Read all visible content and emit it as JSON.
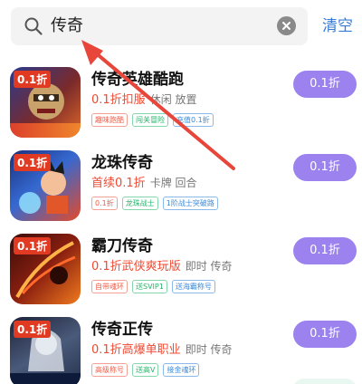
{
  "search": {
    "query": "传奇",
    "cancel_label": "清空"
  },
  "games": [
    {
      "title": "传奇英雄酷跑",
      "promo": "0.1折扣服",
      "category": "休闲 放置",
      "button": "0.1折",
      "icon_badge": "0.1折",
      "tags": [
        {
          "text": "趣味跑酷",
          "color": "red"
        },
        {
          "text": "闯关冒险",
          "color": "green"
        },
        {
          "text": "充值0.1折",
          "color": "blue"
        }
      ]
    },
    {
      "title": "龙珠传奇",
      "promo": "首续0.1折",
      "category": "卡牌 回合",
      "button": "0.1折",
      "icon_badge": "0.1折",
      "tags": [
        {
          "text": "0.1折",
          "color": "red"
        },
        {
          "text": "龙珠战士",
          "color": "green"
        },
        {
          "text": "1阶战士突破路",
          "color": "blue"
        }
      ]
    },
    {
      "title": "霸刀传奇",
      "promo": "0.1折武侠爽玩版",
      "category": "即时 传奇",
      "button": "0.1折",
      "icon_badge": "0.1折",
      "tags": [
        {
          "text": "自带魂环",
          "color": "red"
        },
        {
          "text": "送SVIP1",
          "color": "green"
        },
        {
          "text": "送海霸称号",
          "color": "blue"
        }
      ]
    },
    {
      "title": "传奇正传",
      "promo": "0.1折高爆单职业",
      "category": "即时 传奇",
      "button": "0.1折",
      "icon_badge": "0.1折",
      "tags": [
        {
          "text": "高级称号",
          "color": "red"
        },
        {
          "text": "送高V",
          "color": "green"
        },
        {
          "text": "接金魂环",
          "color": "blue"
        }
      ]
    }
  ],
  "colors": {
    "accent": "#9b82ee",
    "promo": "#f04a32",
    "link": "#3a7bd5",
    "arrow": "#e8463a"
  }
}
